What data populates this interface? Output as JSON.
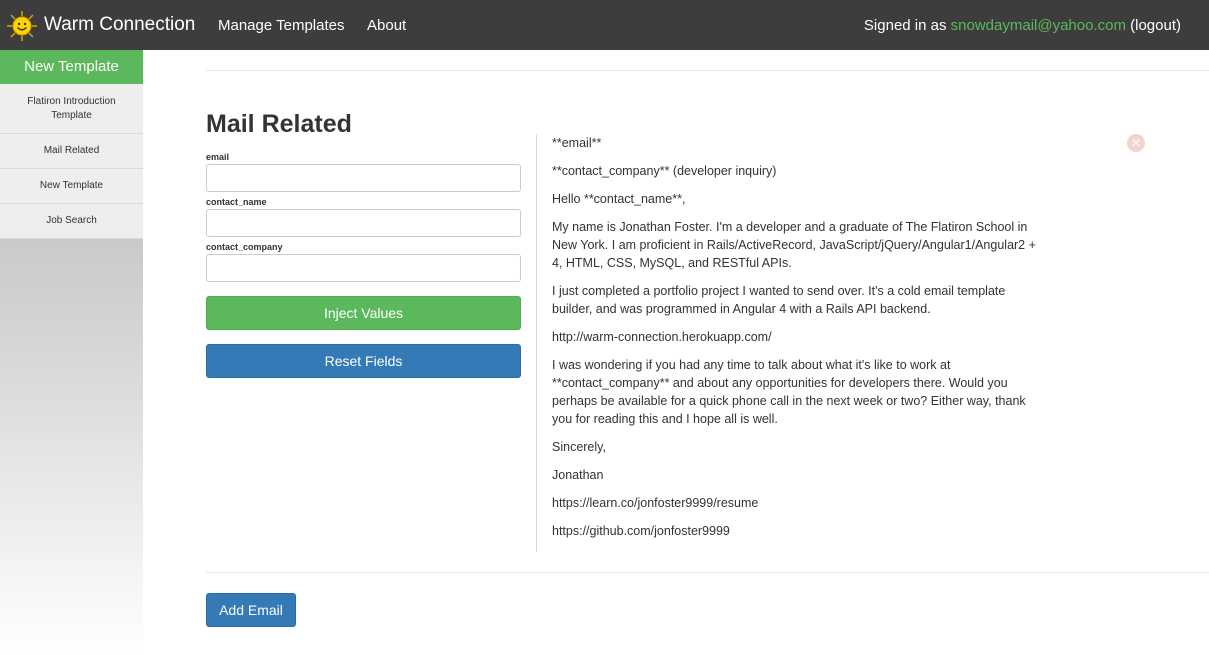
{
  "navbar": {
    "brand": "Warm Connection",
    "logo_icon": "smiley-sun-icon",
    "links": {
      "manage_templates": "Manage Templates",
      "about": "About"
    },
    "signed_in_prefix": "Signed in as",
    "user_email": "snowdaymail@yahoo.com",
    "logout": "(logout)"
  },
  "sidebar": {
    "new_template_label": "New Template",
    "items": [
      {
        "label": "Flatiron Introduction Template"
      },
      {
        "label": "Mail Related"
      },
      {
        "label": "New Template"
      },
      {
        "label": "Job Search"
      }
    ]
  },
  "template": {
    "title": "Mail Related",
    "fields": [
      {
        "label": "email",
        "value": ""
      },
      {
        "label": "contact_name",
        "value": ""
      },
      {
        "label": "contact_company",
        "value": ""
      }
    ],
    "inject_label": "Inject Values",
    "reset_label": "Reset Fields"
  },
  "email": {
    "paragraphs": [
      "**email**",
      "**contact_company** (developer inquiry)",
      "Hello **contact_name**,",
      "My name is Jonathan Foster. I'm a developer and a graduate of The Flatiron School in New York. I am proficient in Rails/ActiveRecord, JavaScript/jQuery/Angular1/Angular2 + 4, HTML, CSS, MySQL, and RESTful APIs.",
      "I just completed a portfolio project I wanted to send over. It's a cold email template builder, and was programmed in Angular 4 with a Rails API backend.",
      "http://warm-connection.herokuapp.com/",
      "I was wondering if you had any time to talk about what it's like to work at **contact_company** and about any opportunities for developers there. Would you perhaps be available for a quick phone call in the next week or two? Either way, thank you for reading this and I hope all is well.",
      "Sincerely,",
      "Jonathan",
      "https://learn.co/jonfoster9999/resume",
      "https://github.com/jonfoster9999"
    ],
    "close_icon": "close-circle-icon"
  },
  "add_email_label": "Add Email",
  "colors": {
    "navbar_bg": "#3d3d3d",
    "success": "#5cb85c",
    "primary": "#337ab7"
  }
}
